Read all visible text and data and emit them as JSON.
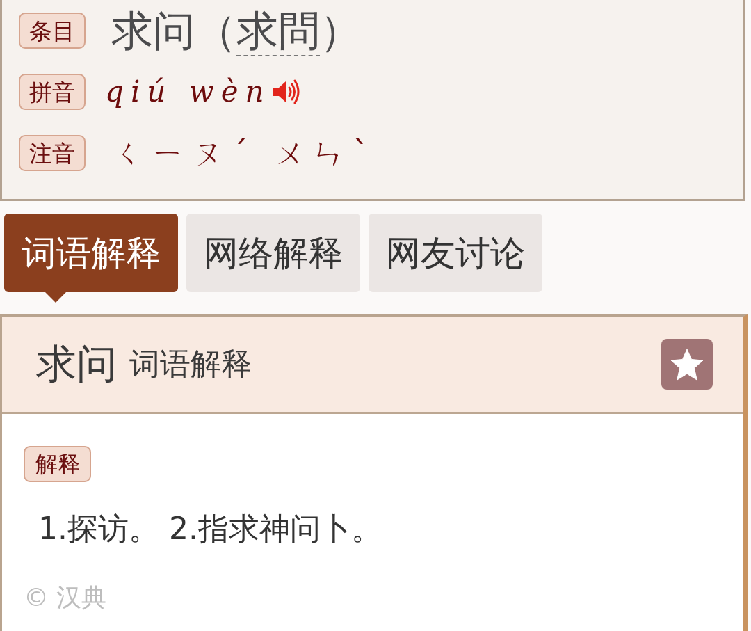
{
  "entry": {
    "label": "条目",
    "title_parts": [
      {
        "kind": "plain",
        "text": "求问（"
      },
      {
        "kind": "link",
        "text": "求問"
      },
      {
        "kind": "plain",
        "text": "）"
      }
    ]
  },
  "pinyin": {
    "label": "拼音",
    "text": "qiú wèn"
  },
  "zhuyin": {
    "label": "注音",
    "text": "ㄑㄧㄡˊ ㄨㄣˋ"
  },
  "tabs": [
    {
      "label": "词语解释",
      "selected": true
    },
    {
      "label": "网络解释",
      "selected": false
    },
    {
      "label": "网友讨论",
      "selected": false
    }
  ],
  "card": {
    "title": "求问",
    "subtitle": "词语解释",
    "section_label": "解释",
    "definition": "1.探访。 2.指求神问卜。",
    "copyright": "© 汉典"
  }
}
